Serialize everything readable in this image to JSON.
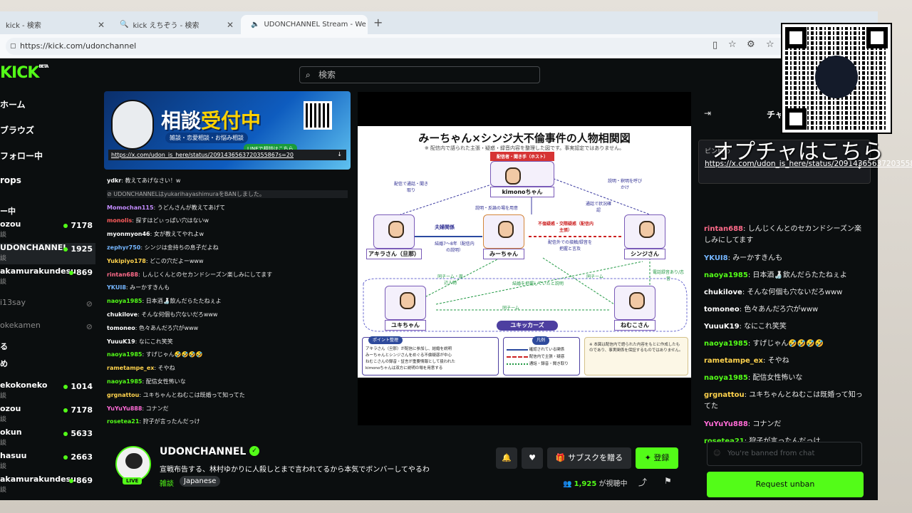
{
  "browser": {
    "tabs": [
      {
        "label": "kick - 検索",
        "close": "✕"
      },
      {
        "label": "kick えちぞう - 検索",
        "close": "✕"
      },
      {
        "label": "UDONCHANNEL Stream - We",
        "close": "✕"
      }
    ],
    "new_tab": "+",
    "url": "https://kick.com/udonchannel"
  },
  "kick": {
    "logo": "KICK",
    "logo_badge": "BETA",
    "search_placeholder": "検索",
    "nav": [
      "ホーム",
      "ブラウズ",
      "フォロー中",
      "rops"
    ],
    "section_header": "ー中",
    "channels": [
      {
        "name": "ozou",
        "category": "談",
        "viewers": "7178",
        "live": true
      },
      {
        "name": "UDONCHANNEL",
        "category": "談",
        "viewers": "1925",
        "live": true
      },
      {
        "name": "akamurakundesu",
        "category": "談",
        "viewers": "869",
        "live": true
      },
      {
        "name": "i13say",
        "category": "",
        "viewers": "",
        "live": false
      },
      {
        "name": "okekamen",
        "category": "",
        "viewers": "",
        "live": false
      },
      {
        "name": "る",
        "category": "",
        "viewers": "",
        "live": false
      },
      {
        "name": "め",
        "category": "",
        "viewers": "",
        "live": false
      },
      {
        "name": "ekokoneko",
        "category": "談",
        "viewers": "1014",
        "live": true
      },
      {
        "name": "ozou",
        "category": "談",
        "viewers": "7178",
        "live": true
      },
      {
        "name": "okun",
        "category": "談",
        "viewers": "5633",
        "live": true
      },
      {
        "name": "hasuu",
        "category": "談",
        "viewers": "2663",
        "live": true
      },
      {
        "name": "akamurakundesu",
        "category": "談",
        "viewers": "869",
        "live": true
      }
    ]
  },
  "banner": {
    "title_a": "相談",
    "title_b": "受付中",
    "sub": "雑談・恋愛相談・お悩み相談",
    "line": "LINEで相談はこちら",
    "link": "https://x.com/udon_is_here/status/2091436563720355867s=20"
  },
  "left_chat": [
    {
      "user": "ydkr",
      "color": "#ffffff",
      "text": "教えてあげなさい！w"
    },
    {
      "user": "",
      "color": "#bbbbbb",
      "text": "UDONCHANNELはyukarihayashimuraをBANしました。"
    },
    {
      "user": "Momochan115",
      "color": "#c38cff",
      "text": "うどんさんが教えてあげて"
    },
    {
      "user": "monolis",
      "color": "#ff5c5c",
      "text": "探すはどぃっぱい穴はないw"
    },
    {
      "user": "myonmyon46",
      "color": "#ffffff",
      "text": "女が教えてやれよw"
    },
    {
      "user": "zephyr750",
      "color": "#75b6ff",
      "text": "シンジは金持ちの息子だよね"
    },
    {
      "user": "Yukipiyo178",
      "color": "#ffd34d",
      "text": "どこの穴だよーwww"
    },
    {
      "user": "rintan688",
      "color": "#ff6b8a",
      "text": "しんじくんとのセカンドシーズン楽しみにしてます"
    },
    {
      "user": "YKUI8",
      "color": "#75b6ff",
      "text": "みーかすきんも"
    },
    {
      "user": "naoya1985",
      "color": "#53fc18",
      "text": "日本酒🍶飲んだらたたねぇよ"
    },
    {
      "user": "chukilove",
      "color": "#ffffff",
      "text": "そんな何個も穴ないだろwww"
    },
    {
      "user": "tomoneo",
      "color": "#ffffff",
      "text": "色々あんだろ穴がwww"
    },
    {
      "user": "YuuuK19",
      "color": "#ffffff",
      "text": "なにこれ笑笑"
    },
    {
      "user": "naoya1985",
      "color": "#53fc18",
      "text": "すげじゃん🤣🤣🤣🤣"
    },
    {
      "user": "rametampe_ex",
      "color": "#ffd34d",
      "text": "そやね"
    },
    {
      "user": "naoya1985",
      "color": "#53fc18",
      "text": "配信女性怖いな"
    },
    {
      "user": "grgnattou",
      "color": "#ffd34d",
      "text": "ユキちゃんとねむこは既婚って知ってた"
    },
    {
      "user": "YuYuYu888",
      "color": "#ff6bd6",
      "text": "コナンだ"
    },
    {
      "user": "rosetea21",
      "color": "#53fc18",
      "text": "狩子が言ったんだっけ"
    }
  ],
  "slide": {
    "title": "みーちゃん×シンジ大不倫事件の人物相関図",
    "subtitle": "※ 配信内で語られた主張・疑惑・録音内容を整理した図です。事実認定ではありません。",
    "host_tag": "配信者・聞き手（ホスト）",
    "people": {
      "kimono": "kimonoちゃん",
      "akira": "アキラさん（旦那）",
      "mii": "みーちゃん",
      "shinji": "シンジさん",
      "yuki": "ユキちゃん",
      "nemuko": "ねむこさん"
    },
    "relations": {
      "fufu": "夫婦関係",
      "fufu_sub": "結婚7〜8年（配信内の説明）",
      "furin": "不倫疑惑・交際疑惑（配信内主張）",
      "call1": "配信で通話・聞き取り",
      "explain": "説明・釈明を呼びかけ",
      "hanron": "説明・反論の場を用意",
      "tsuwa": "通話で状況確認",
      "same1": "同チーム・周辺人物",
      "same2": "同チーム",
      "same3": "同チーム",
      "rokuon": "電話録音あり/恋音",
      "kekkon": "結婚を把握していたと説明",
      "haishin": "配信外での接触/録音を把握と言及"
    },
    "group": "ユキッカーズ",
    "points_header": "ポイント整理",
    "points": [
      "アキラさん（旦那）が配信に参加し、結婚を説明",
      "みーちゃんとシンジさんをめぐる不倫疑惑が中心",
      "ねむこさんの録音・証言が重要情報として扱われた",
      "kimonoちゃんは双方に説明の場を用意する"
    ],
    "legend_header": "凡例",
    "legend": [
      "確認されている関係",
      "配信内で主張・疑惑",
      "通話・録音・聞き取り"
    ],
    "note": "※ 本図は配信内で語られた内容をもとに作成したものであり、事実関係を保証するものではありません。"
  },
  "stream": {
    "channel": "UDONCHANNEL",
    "live": "LIVE",
    "title": "宣戦布告する、林村ゆかりに人殺しとまで言われてるから本気でボンバーしてやるわ",
    "category": "雑談",
    "language": "Japanese",
    "subscribe_gift": "サブスクを贈る",
    "follow": "登録",
    "viewers": "1,925",
    "viewers_suffix": "が視聴中"
  },
  "right_chat": {
    "header": "チャ",
    "pinned_label": "ピン留め",
    "pinned_link": "https://x.com/udon_is_here/status/2091436563720355867s=20",
    "messages": [
      {
        "user": "rintan688",
        "color": "#ff6b8a",
        "text": "しんじくんとのセカンドシーズン楽しみにしてます"
      },
      {
        "user": "YKUI8",
        "color": "#75b6ff",
        "text": "みーかすきんも"
      },
      {
        "user": "naoya1985",
        "color": "#53fc18",
        "text": "日本酒🍶飲んだらたたねぇよ"
      },
      {
        "user": "chukilove",
        "color": "#ffffff",
        "text": "そんな何個も穴ないだろwww"
      },
      {
        "user": "tomoneo",
        "color": "#ffffff",
        "text": "色々あんだろ穴がwww"
      },
      {
        "user": "YuuuK19",
        "color": "#ffffff",
        "text": "なにこれ笑笑"
      },
      {
        "user": "naoya1985",
        "color": "#53fc18",
        "text": "すげじゃん🤣🤣🤣🤣"
      },
      {
        "user": "rametampe_ex",
        "color": "#ffd34d",
        "text": "そやね"
      },
      {
        "user": "naoya1985",
        "color": "#53fc18",
        "text": "配信女性怖いな"
      },
      {
        "user": "grgnattou",
        "color": "#ffd34d",
        "text": "ユキちゃんとねむこは既婚って知ってた"
      },
      {
        "user": "YuYuYu888",
        "color": "#ff6bd6",
        "text": "コナンだ"
      },
      {
        "user": "rosetea21",
        "color": "#53fc18",
        "text": "狩子が言ったんだっけ"
      }
    ],
    "input_placeholder": "You're banned from chat",
    "unban": "Request unban"
  },
  "overlay": {
    "text": "オプチャはこちら"
  },
  "colors": {
    "accent": "#53fc18",
    "bg": "#0b0e0f"
  }
}
